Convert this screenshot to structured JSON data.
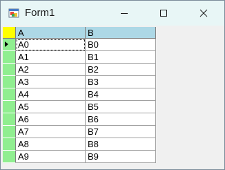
{
  "window": {
    "title": "Form1"
  },
  "grid": {
    "columns": [
      "A",
      "B"
    ],
    "rows": [
      [
        "A0",
        "B0"
      ],
      [
        "A1",
        "B1"
      ],
      [
        "A2",
        "B2"
      ],
      [
        "A3",
        "B3"
      ],
      [
        "A4",
        "B4"
      ],
      [
        "A5",
        "B5"
      ],
      [
        "A6",
        "B6"
      ],
      [
        "A7",
        "B7"
      ],
      [
        "A8",
        "B8"
      ],
      [
        "A9",
        "B9"
      ]
    ],
    "current_row": 0
  },
  "colors": {
    "titlebar": "#e8f6f6",
    "corner_header": "#ffff00",
    "column_header": "#add8e6",
    "row_header": "#90ee90"
  }
}
